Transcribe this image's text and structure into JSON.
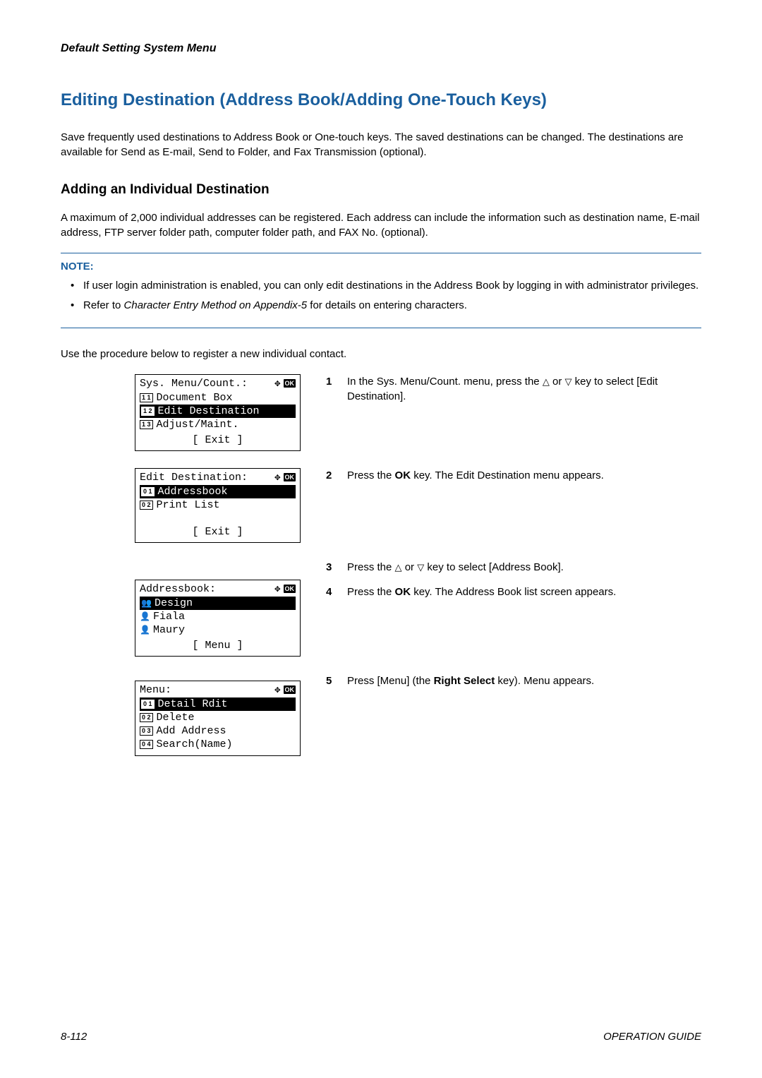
{
  "header": "Default Setting System Menu",
  "title": "Editing Destination (Address Book/Adding One-Touch Keys)",
  "intro": "Save frequently used destinations to Address Book or One-touch keys. The saved destinations can be changed. The destinations are available for Send as E-mail, Send to Folder, and Fax Transmission (optional).",
  "subhead": "Adding an Individual Destination",
  "para1": "A maximum of 2,000 individual addresses can be registered. Each address can include the information such as destination name, E-mail address, FTP server folder path, computer folder path, and FAX No. (optional).",
  "note_label": "NOTE:",
  "note_items": [
    "If user login administration is enabled, you can only edit destinations in the Address Book by logging in with administrator privileges.",
    "Refer to Character Entry Method on Appendix-5 for details on entering characters."
  ],
  "procedure_intro": "Use the procedure below to register a new individual contact.",
  "ok_label": "OK",
  "lcd1": {
    "title": "Sys. Menu/Count.:",
    "rows": [
      {
        "num": "1 1",
        "text": "Document Box",
        "sel": false
      },
      {
        "num": "1 2",
        "text": "Edit Destination",
        "sel": true
      },
      {
        "num": "1 3",
        "text": "Adjust/Maint.",
        "sel": false
      }
    ],
    "softkey": "[  Exit   ]"
  },
  "lcd2": {
    "title": "Edit Destination:",
    "rows": [
      {
        "num": "0 1",
        "text": "Addressbook",
        "sel": true,
        "inv": true
      },
      {
        "num": "0 2",
        "text": "Print List",
        "sel": false
      }
    ],
    "softkey": "[  Exit   ]"
  },
  "lcd3": {
    "title": "Addressbook:",
    "rows": [
      {
        "icon": "group",
        "text": "Design",
        "sel": true
      },
      {
        "icon": "person",
        "text": "Fiala",
        "sel": false
      },
      {
        "icon": "person",
        "text": "Maury",
        "sel": false
      }
    ],
    "softkey": "[  Menu   ]"
  },
  "lcd4": {
    "title": "Menu:",
    "rows": [
      {
        "num": "0 1",
        "text": "Detail Rdit",
        "sel": true,
        "inv": true
      },
      {
        "num": "0 2",
        "text": "Delete",
        "sel": false
      },
      {
        "num": "0 3",
        "text": "Add Address",
        "sel": false
      },
      {
        "num": "0 4",
        "text": "Search(Name)",
        "sel": false
      }
    ]
  },
  "steps": {
    "s1_a": "In the Sys. Menu/Count. menu, press the ",
    "s1_b": " or ",
    "s1_c": " key to select [Edit Destination].",
    "s2_a": "Press the ",
    "s2_b": "OK",
    "s2_c": " key. The Edit Destination menu appears.",
    "s3_a": "Press the ",
    "s3_b": " or ",
    "s3_c": " key to select [Address Book].",
    "s4_a": "Press the ",
    "s4_b": "OK",
    "s4_c": " key. The Address Book list screen appears.",
    "s5_a": "Press [Menu] (the ",
    "s5_b": "Right Select",
    "s5_c": " key). Menu appears."
  },
  "footer_left": "8-112",
  "footer_right": "OPERATION GUIDE"
}
